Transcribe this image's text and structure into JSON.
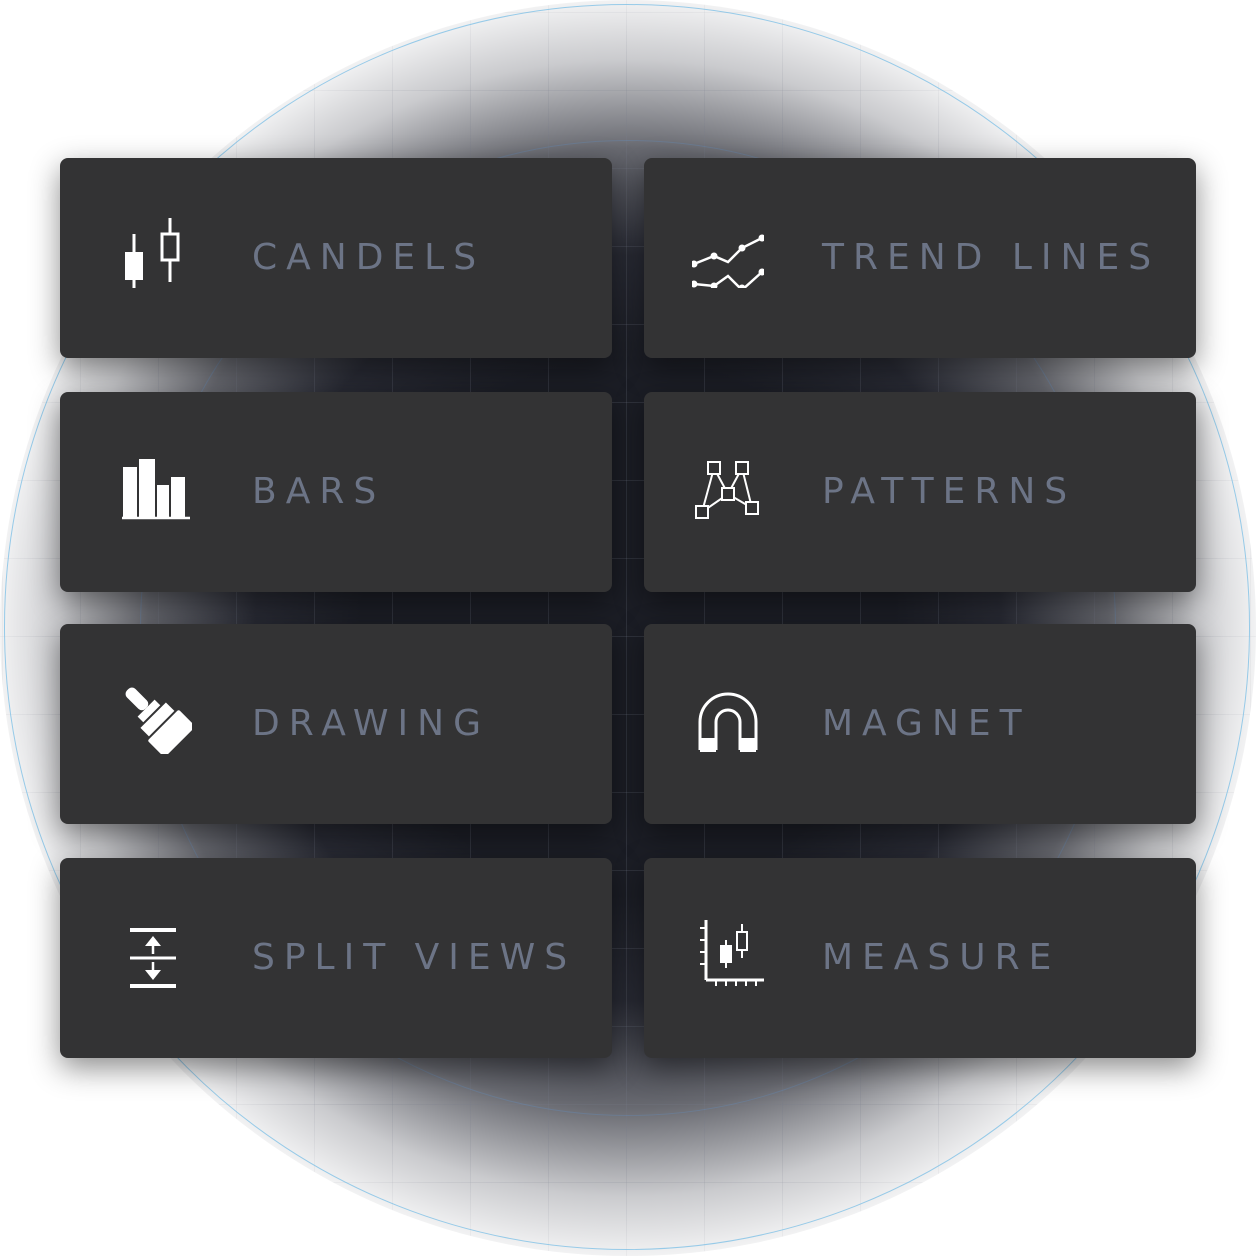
{
  "cards": [
    {
      "label": "CANDELS",
      "icon": "candlestick-icon"
    },
    {
      "label": "TREND LINES",
      "icon": "trend-lines-icon"
    },
    {
      "label": "BARS",
      "icon": "bar-chart-icon"
    },
    {
      "label": "PATTERNS",
      "icon": "pattern-nodes-icon"
    },
    {
      "label": "DRAWING",
      "icon": "paintbrush-icon"
    },
    {
      "label": "MAGNET",
      "icon": "magnet-icon"
    },
    {
      "label": "SPLIT VIEWS",
      "icon": "split-views-icon"
    },
    {
      "label": "MEASURE",
      "icon": "measure-chart-icon"
    }
  ],
  "colors": {
    "card_bg": "#333334",
    "label": "#6c7486",
    "icon": "#ffffff",
    "ring": "#78bee6"
  }
}
